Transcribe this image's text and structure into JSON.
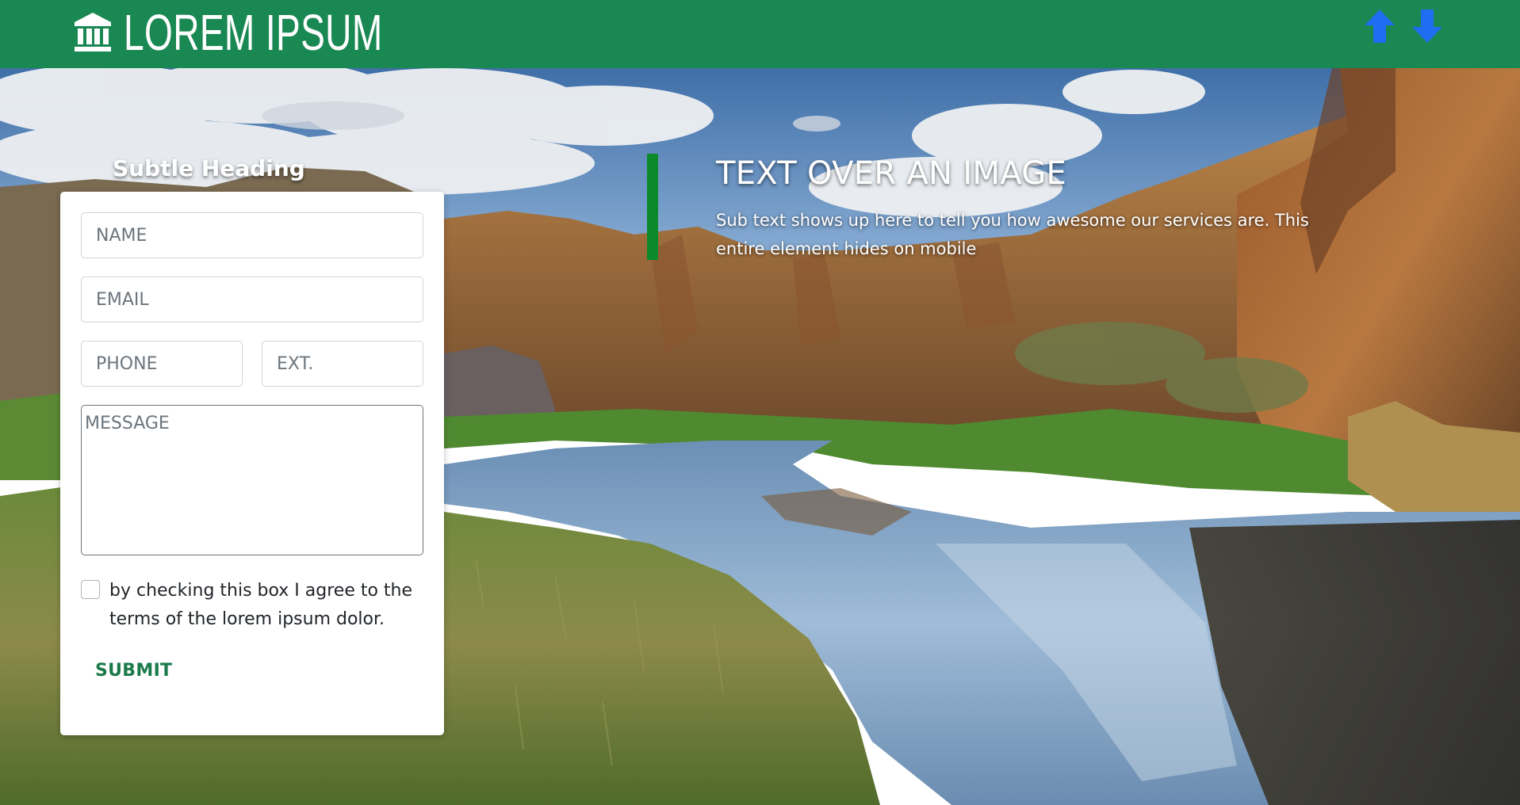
{
  "header": {
    "brand_name": "LOREM IPSUM",
    "brand_icon": "bank-icon",
    "nav": {
      "up_icon": "arrow-up-icon",
      "down_icon": "arrow-down-icon"
    },
    "colors": {
      "background": "#1a8852",
      "arrows": "#1e6ef2"
    }
  },
  "form": {
    "heading": "Subtle Heading",
    "name_placeholder": "NAME",
    "email_placeholder": "EMAIL",
    "phone_placeholder": "PHONE",
    "ext_placeholder": "EXT.",
    "message_placeholder": "MESSAGE",
    "agree_text": "by checking this box I agree to the terms of the lorem ipsum dolor.",
    "submit_label": "SUBMIT",
    "colors": {
      "submit": "#1a7a4a"
    }
  },
  "hero": {
    "title": "TEXT OVER AN IMAGE",
    "subtext": "Sub text shows up here to tell you how awesome our services are. This entire element hides on mobile",
    "accent_color": "#0b8a2b"
  }
}
